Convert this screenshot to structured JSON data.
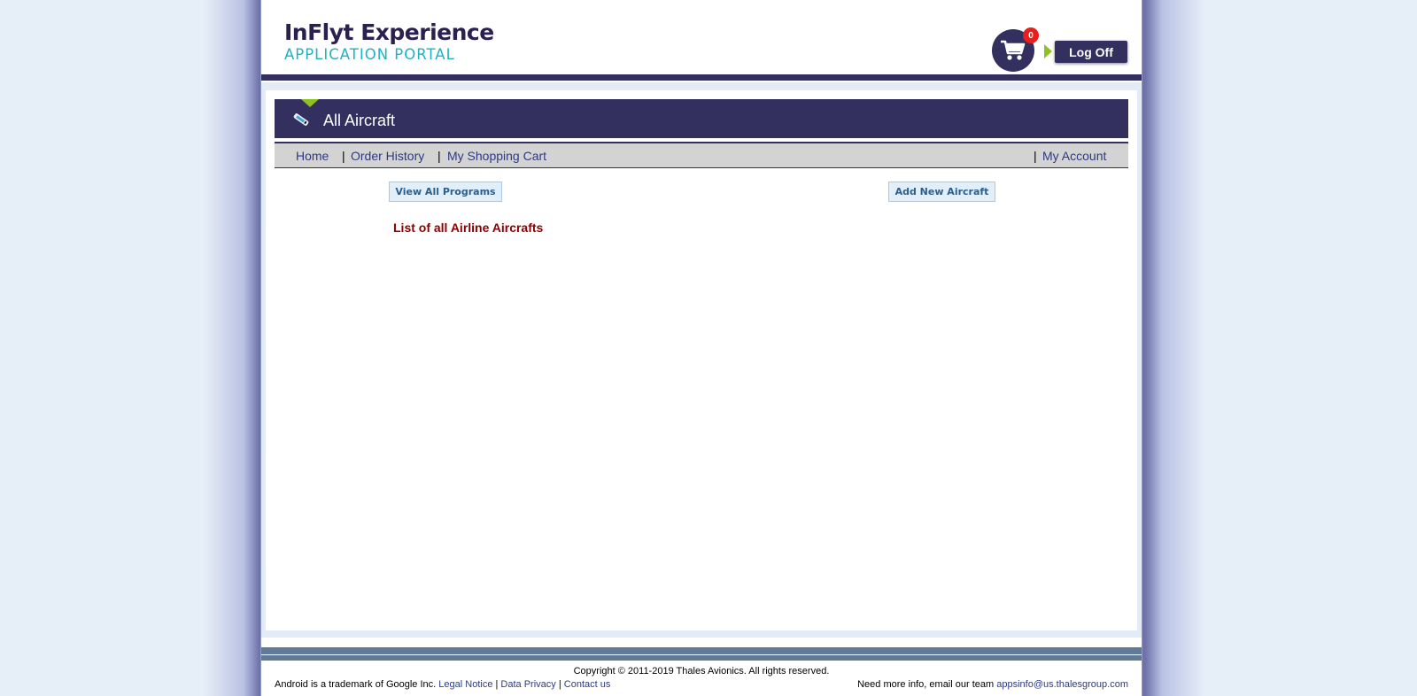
{
  "header": {
    "logo_title": "InFlyt Experience",
    "logo_subtitle": "APPLICATION PORTAL",
    "cart_count": "0",
    "logoff_label": "Log Off"
  },
  "page": {
    "title": "All Aircraft"
  },
  "nav": {
    "home": "Home",
    "order_history": "Order History",
    "shopping_cart": "My Shopping Cart",
    "my_account": "My Account",
    "separator": "|"
  },
  "actions": {
    "view_all_programs": "View All Programs",
    "add_new_aircraft": "Add New Aircraft"
  },
  "main": {
    "list_heading": "List of all Airline Aircrafts"
  },
  "footer": {
    "copyright": "Copyright © 2011-2019 Thales Avionics. All rights reserved.",
    "android_notice": "Android is a trademark of Google Inc.",
    "legal_notice": "Legal Notice",
    "data_privacy": "Data Privacy",
    "contact_us": "Contact us",
    "separator": "|",
    "info_text": "Need more info, email our team",
    "email": "appsinfo@us.thalesgroup.com"
  },
  "colors": {
    "brand_navy": "#33305f",
    "accent_green": "#8dc21f",
    "heading_red": "#8b0000",
    "link_blue": "#2e3a80"
  }
}
